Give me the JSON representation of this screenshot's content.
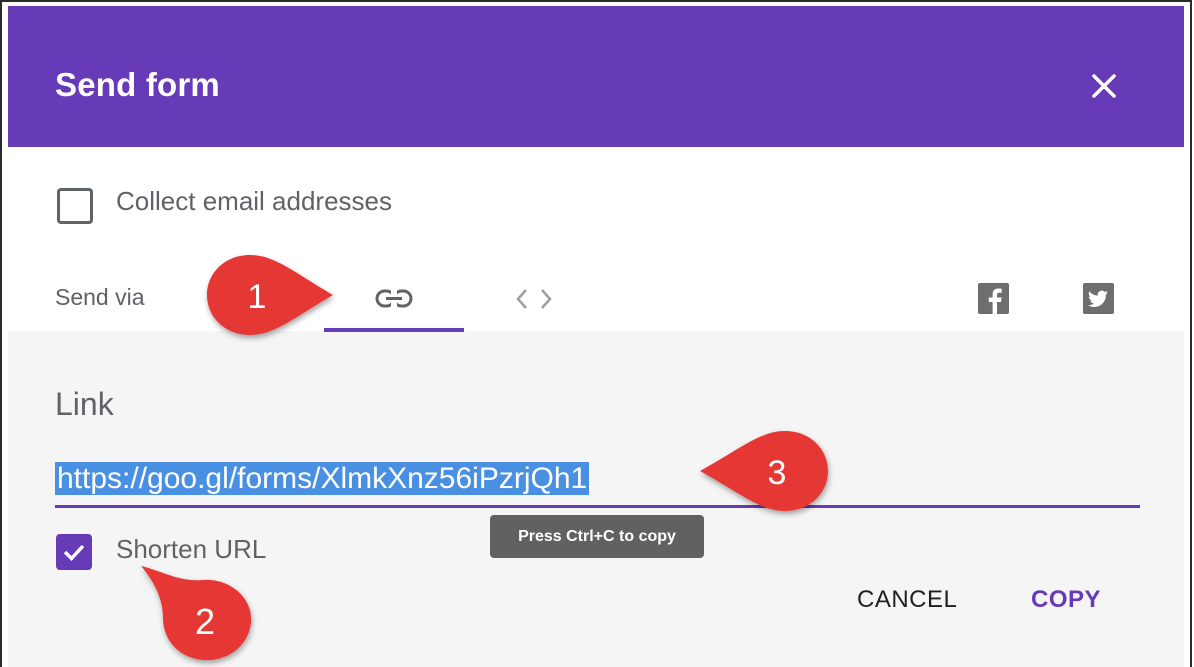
{
  "dialog": {
    "title": "Send form",
    "close_icon": "close-icon"
  },
  "options": {
    "collect_email_label": "Collect email addresses",
    "collect_email_checked": false
  },
  "send_via": {
    "label": "Send via",
    "tabs": [
      {
        "icon": "link-icon",
        "selected": true
      },
      {
        "icon": "embed-code-icon",
        "selected": false
      }
    ],
    "social": [
      {
        "icon": "facebook-icon"
      },
      {
        "icon": "twitter-icon"
      }
    ]
  },
  "link_panel": {
    "heading": "Link",
    "url": "https://goo.gl/forms/XlmkXnz56iPzrjQh1",
    "tooltip": "Press Ctrl+C to copy",
    "shorten_label": "Shorten URL",
    "shorten_checked": true
  },
  "actions": {
    "cancel_label": "CANCEL",
    "copy_label": "COPY"
  },
  "annotations": {
    "callout_1": "1",
    "callout_2": "2",
    "callout_3": "3"
  },
  "colors": {
    "accent": "#673ab7",
    "callout_red": "#e53935",
    "selection_blue": "#4a90e2"
  }
}
